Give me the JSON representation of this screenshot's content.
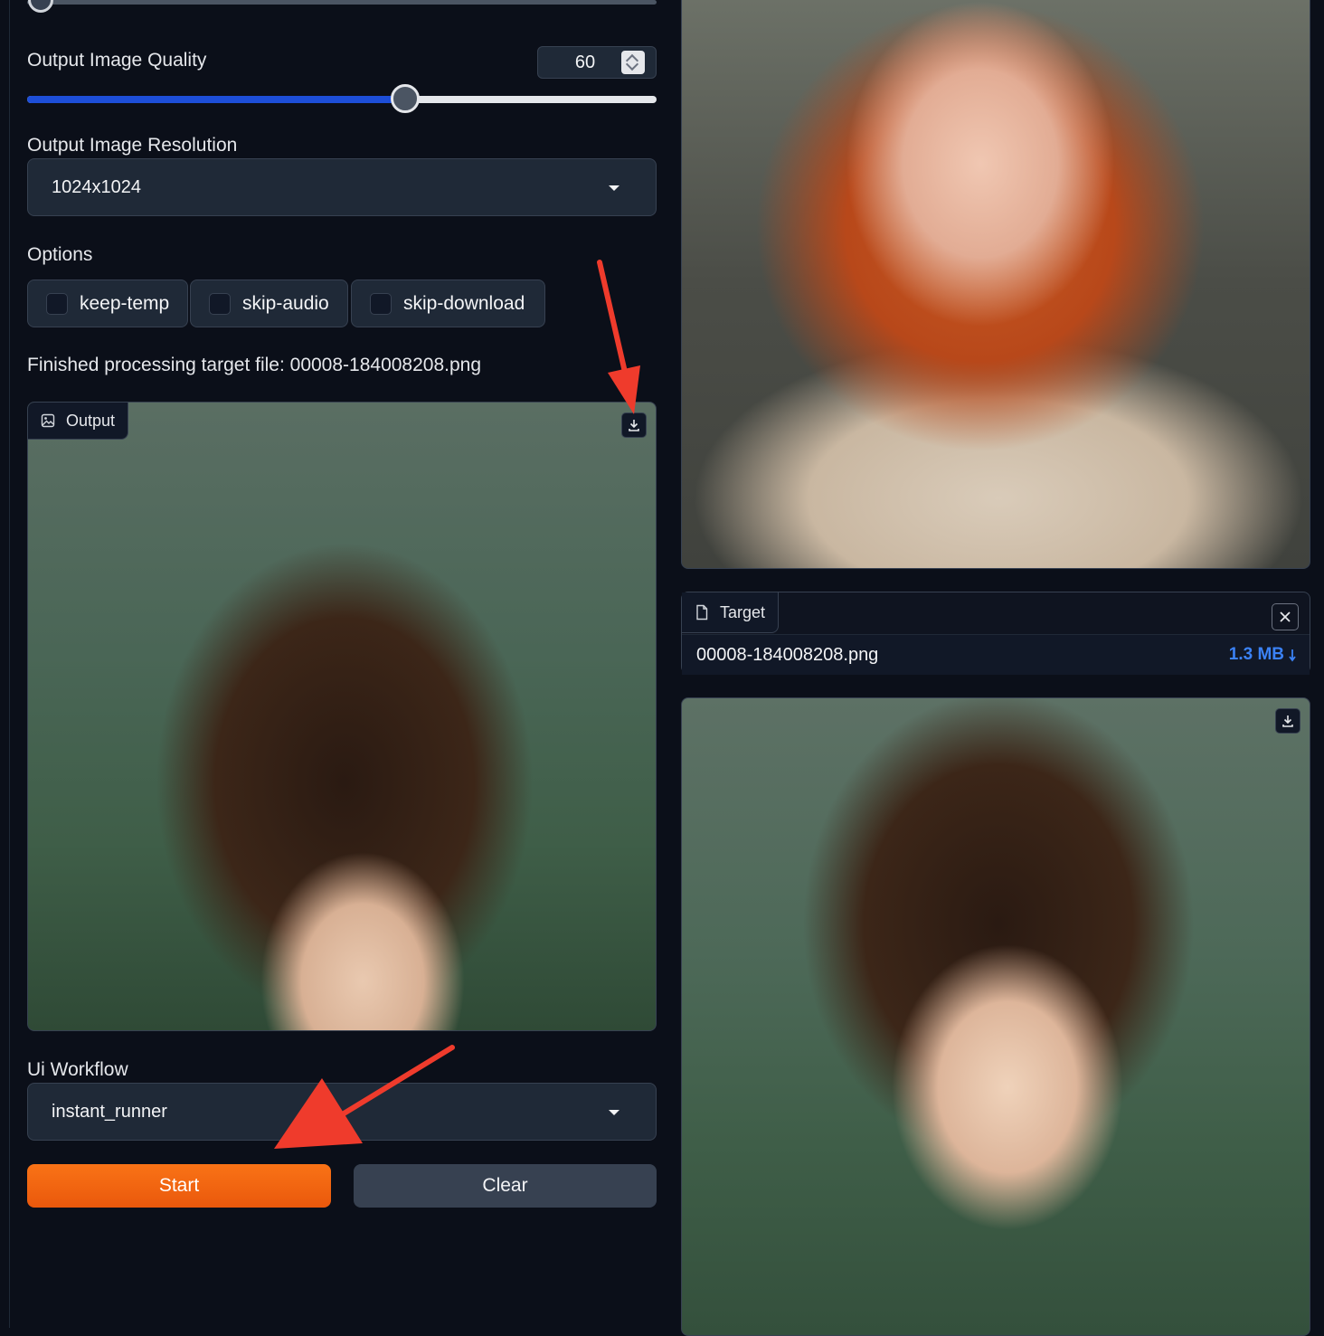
{
  "settings": {
    "quality": {
      "label": "Output Image Quality",
      "value": "60",
      "percent": 60
    },
    "resolution": {
      "label": "Output Image Resolution",
      "value": "1024x1024"
    },
    "options": {
      "label": "Options",
      "items": [
        {
          "label": "keep-temp",
          "checked": false
        },
        {
          "label": "skip-audio",
          "checked": false
        },
        {
          "label": "skip-download",
          "checked": false
        }
      ]
    },
    "status": "Finished processing target file: 00008-184008208.png",
    "output_panel": {
      "label": "Output",
      "icon": "image-icon",
      "download_icon": "download-icon"
    },
    "workflow": {
      "label": "Ui Workflow",
      "value": "instant_runner"
    },
    "buttons": {
      "start": "Start",
      "clear": "Clear"
    }
  },
  "target": {
    "label": "Target",
    "icon": "file-icon",
    "filename": "00008-184008208.png",
    "size": "1.3 MB"
  },
  "colors": {
    "background": "#0b0f19",
    "accent_orange": "#f97316",
    "slider_fill": "#1d4ed8",
    "file_size_link": "#3b82f6",
    "annotation_arrow": "#ef3b2c"
  }
}
